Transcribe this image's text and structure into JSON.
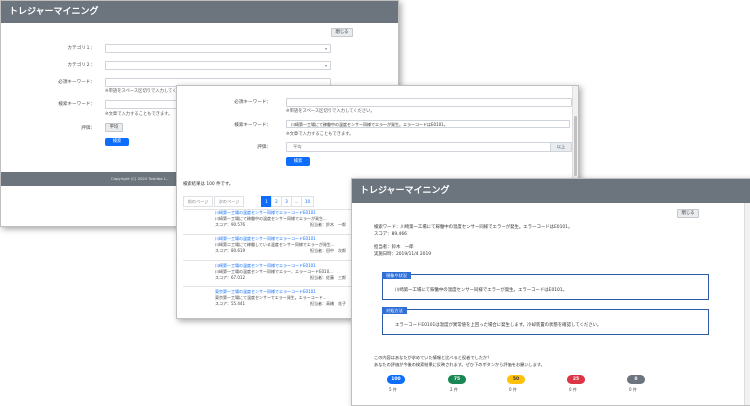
{
  "w1": {
    "title": "トレジャーマイニング",
    "close_label": "閉じる",
    "labels": {
      "cat1": "カテゴリ１：",
      "cat2": "カテゴリ２：",
      "must": "必須キーワード：",
      "search": "検索キーワード：",
      "rating": "評価："
    },
    "must_note": "※単語をスペース区切りで入力してください。",
    "search_note": "※文章で入力することもできます。",
    "rating_value": "平均",
    "search_button": "検索",
    "footer": "Copyright (C) 2020 Toshiba I..."
  },
  "w2": {
    "labels": {
      "must": "必須キーワード：",
      "search": "検索キーワード：",
      "rating": "評価："
    },
    "must_note": "※単語をスペース区切りで入力してください。",
    "search_value": "川崎第一工場にて稼働中の温度センサー同様でエラーが発生。エラーコードはE0101。",
    "search_note": "※文章で入力することもできます。",
    "rating_value": "平均",
    "rating_right": "以上",
    "search_button": "検索",
    "result_count": "検索結果は 100 件です。",
    "pager": {
      "prev": "前のページ",
      "next": "次のページ",
      "pages": [
        "1",
        "2",
        "3",
        "...",
        "10"
      ]
    },
    "results": [
      {
        "title": "川崎第一工場の温度センサー同様でエラーコードE0101",
        "body": "川崎第一工場にて稼働中の温度センサー同様でエラーが発生...",
        "score": "スコア：90.576",
        "who": "担当者：鈴木　一郎"
      },
      {
        "title": "川崎第一工場の温度センサー同様でエラーコードE0101",
        "body": "川崎第二工場にて稼働している温度センサー同様でエラーが発生...",
        "score": "スコア：80.619",
        "who": "担当者：田中　次郎"
      },
      {
        "title": "川崎第一工場の温度センサー同様でエラーコードE0101",
        "body": "川崎第一工場の温度センサー同様でエラー、エラーコードE010...",
        "score": "スコア：67.012",
        "who": "担当者：佐藤　三郎"
      },
      {
        "title": "東京第一工場の温度センサー同様でエラーコードE0101",
        "body": "東京第一工場にて温度センサーでエラー発生。エラーコード...",
        "score": "スコア：55.441",
        "who": "担当者：高橋　花子"
      }
    ]
  },
  "w3": {
    "title": "トレジャーマイニング",
    "close_label": "閉じる",
    "search_keyword": "検索ワード：川崎第一工場にて稼働中の温度センサー同様でエラーが発生。エラーコードはE0101。",
    "score": "スコア：89.466",
    "person": "担当者：鈴木　一郎",
    "date": "実施日時：2019/11/4 2019",
    "panel1_title": "現象や状況",
    "panel1_body": "川崎第一工場にて稼働中の温度センサー同様でエラーが発生。エラーコードはE0101。",
    "panel2_title": "対処方法",
    "panel2_body": "エラーコードE0101は温度が異常値を上回った場合に発生します。冷却装置の状態を確認してください。",
    "question": "この内容はあなたが求めていた情報と比べると役者でしたか？",
    "question2": "あなたの評価が今後の検索結果に反映されます。ぜひ下のボタンから評価をお願いします。",
    "ratings": [
      {
        "label": "100",
        "count": "5 件",
        "color": "#0d6efd"
      },
      {
        "label": "75",
        "count": "2 件",
        "color": "#198754"
      },
      {
        "label": "50",
        "count": "0 件",
        "color": "#ffc107"
      },
      {
        "label": "25",
        "count": "0 件",
        "color": "#dc3545"
      },
      {
        "label": "0",
        "count": "0 件",
        "color": "#6c757d"
      }
    ]
  }
}
